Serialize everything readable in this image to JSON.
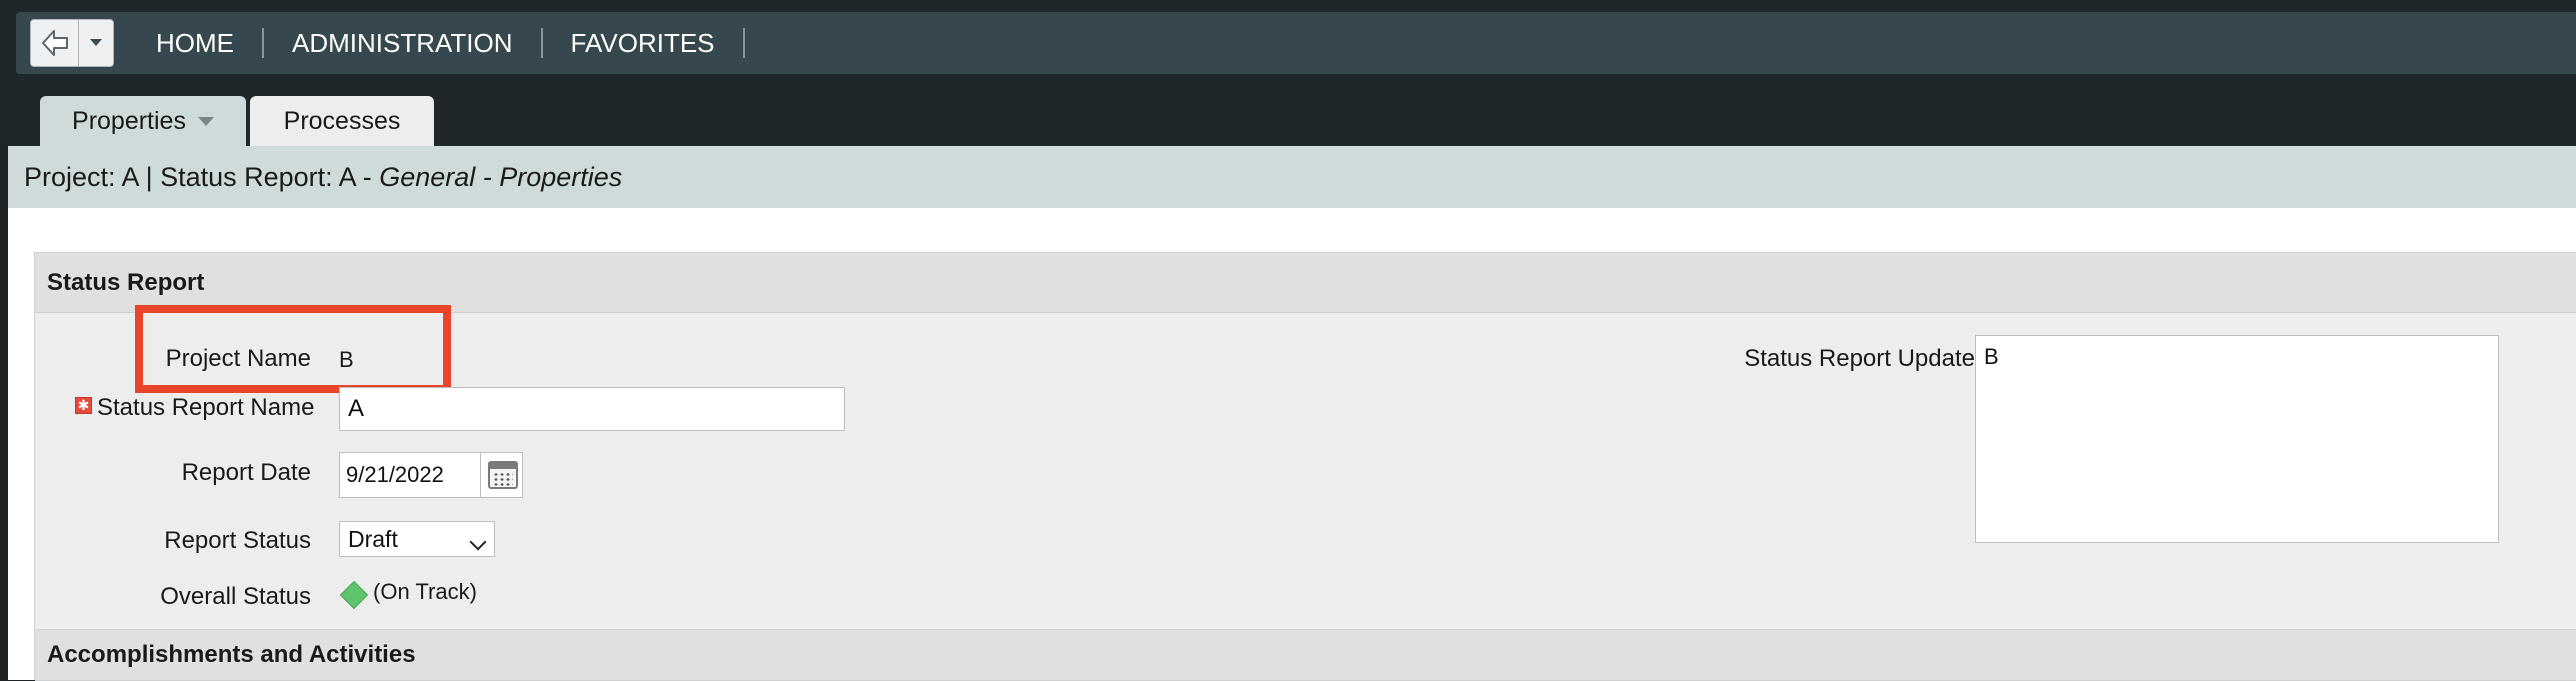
{
  "nav": {
    "items": [
      "HOME",
      "ADMINISTRATION",
      "FAVORITES"
    ]
  },
  "tabs": {
    "properties": "Properties",
    "processes": "Processes"
  },
  "title": {
    "prefix": "Project: A | Status Report: A - ",
    "italic": "General - Properties"
  },
  "sections": {
    "status_report": "Status Report",
    "accomplishments": "Accomplishments and Activities"
  },
  "fields": {
    "project_name_label": "Project Name",
    "project_name_value": "B",
    "status_report_name_label": "Status Report Name",
    "status_report_name_value": "A",
    "report_date_label": "Report Date",
    "report_date_value": "9/21/2022",
    "report_status_label": "Report Status",
    "report_status_value": "Draft",
    "overall_status_label": "Overall Status",
    "overall_status_value": "(On Track)",
    "status_report_update_label": "Status Report Update",
    "status_report_update_value": "B"
  },
  "colors": {
    "highlight": "#e8452b",
    "on_track": "#5fc46b",
    "required": "#e64a3b"
  }
}
